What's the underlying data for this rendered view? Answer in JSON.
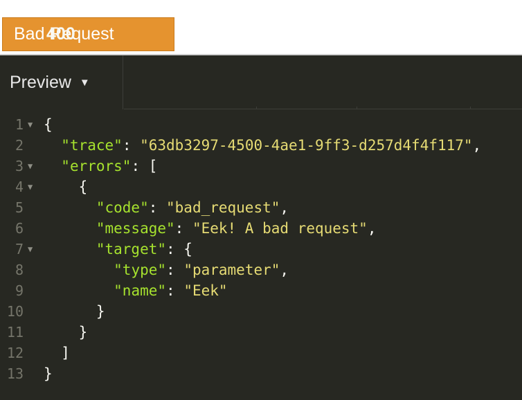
{
  "status": {
    "code": "400",
    "text": "Bad Request",
    "color": "#e5932f"
  },
  "tab": {
    "label": "Preview",
    "icon": "caret-down-icon"
  },
  "colors": {
    "editor_bg": "#272822",
    "key": "#a6e22e",
    "string": "#e6db74",
    "punctuation": "#f8f8f2",
    "line_number": "#75756a"
  },
  "lines": [
    {
      "n": "1",
      "fold": true,
      "tokens": [
        {
          "t": "p",
          "v": "{"
        }
      ]
    },
    {
      "n": "2",
      "fold": false,
      "tokens": [
        {
          "t": "p",
          "v": "  "
        },
        {
          "t": "key",
          "v": "\"trace\""
        },
        {
          "t": "p",
          "v": ": "
        },
        {
          "t": "str",
          "v": "\"63db3297-4500-4ae1-9ff3-d257d4f4f117\""
        },
        {
          "t": "p",
          "v": ","
        }
      ]
    },
    {
      "n": "3",
      "fold": true,
      "tokens": [
        {
          "t": "p",
          "v": "  "
        },
        {
          "t": "key",
          "v": "\"errors\""
        },
        {
          "t": "p",
          "v": ": ["
        }
      ]
    },
    {
      "n": "4",
      "fold": true,
      "tokens": [
        {
          "t": "p",
          "v": "    {"
        }
      ]
    },
    {
      "n": "5",
      "fold": false,
      "tokens": [
        {
          "t": "p",
          "v": "      "
        },
        {
          "t": "key",
          "v": "\"code\""
        },
        {
          "t": "p",
          "v": ": "
        },
        {
          "t": "str",
          "v": "\"bad_request\""
        },
        {
          "t": "p",
          "v": ","
        }
      ]
    },
    {
      "n": "6",
      "fold": false,
      "tokens": [
        {
          "t": "p",
          "v": "      "
        },
        {
          "t": "key",
          "v": "\"message\""
        },
        {
          "t": "p",
          "v": ": "
        },
        {
          "t": "str",
          "v": "\"Eek! A bad request\""
        },
        {
          "t": "p",
          "v": ","
        }
      ]
    },
    {
      "n": "7",
      "fold": true,
      "tokens": [
        {
          "t": "p",
          "v": "      "
        },
        {
          "t": "key",
          "v": "\"target\""
        },
        {
          "t": "p",
          "v": ": {"
        }
      ]
    },
    {
      "n": "8",
      "fold": false,
      "tokens": [
        {
          "t": "p",
          "v": "        "
        },
        {
          "t": "key",
          "v": "\"type\""
        },
        {
          "t": "p",
          "v": ": "
        },
        {
          "t": "str",
          "v": "\"parameter\""
        },
        {
          "t": "p",
          "v": ","
        }
      ]
    },
    {
      "n": "9",
      "fold": false,
      "tokens": [
        {
          "t": "p",
          "v": "        "
        },
        {
          "t": "key",
          "v": "\"name\""
        },
        {
          "t": "p",
          "v": ": "
        },
        {
          "t": "str",
          "v": "\"Eek\""
        }
      ]
    },
    {
      "n": "10",
      "fold": false,
      "tokens": [
        {
          "t": "p",
          "v": "      }"
        }
      ]
    },
    {
      "n": "11",
      "fold": false,
      "tokens": [
        {
          "t": "p",
          "v": "    }"
        }
      ]
    },
    {
      "n": "12",
      "fold": false,
      "tokens": [
        {
          "t": "p",
          "v": "  ]"
        }
      ]
    },
    {
      "n": "13",
      "fold": false,
      "tokens": [
        {
          "t": "p",
          "v": "}"
        }
      ]
    }
  ]
}
